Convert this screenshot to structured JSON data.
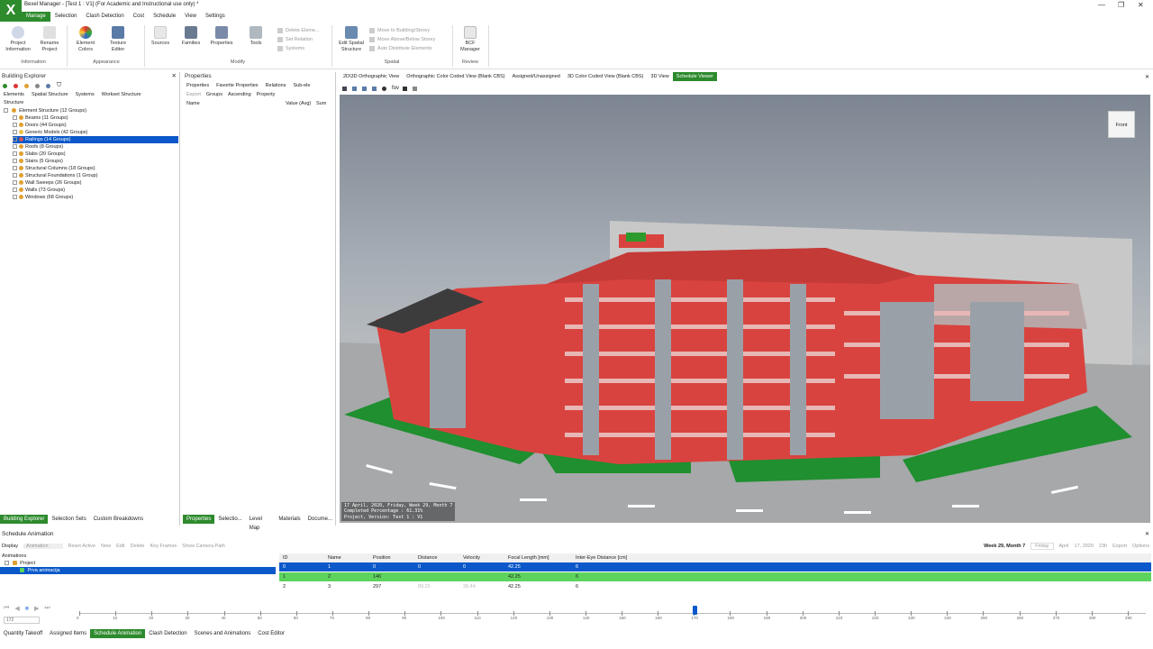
{
  "window": {
    "title": "Bexel Manager - [Test 1 : V1] (For Academic and Instructional use only) *",
    "logo": "X"
  },
  "menu": [
    "Manage",
    "Selection",
    "Clash Detection",
    "Cost",
    "Schedule",
    "View",
    "Settings"
  ],
  "ribbon": {
    "buttons": {
      "project_info": "Project Information",
      "rename_project": "Rename Project",
      "element_colors": "Element Colors",
      "texture_editor": "Texture Editor",
      "sources": "Sources",
      "families": "Families",
      "properties": "Properties",
      "tools": "Tools",
      "edit_spatial": "Edit Spatial Structure",
      "bcf_manager": "BCF Manager"
    },
    "small_items": {
      "delete_elements": "Delete Eleme...",
      "set_relation": "Set Relation",
      "systems": "Systems",
      "move_building": "Move to Building/Storey",
      "move_above": "Move Above/Below Storey",
      "auto_distribute": "Auto Distribute Elements"
    },
    "groups": {
      "information": "Information",
      "appearance": "Appearance",
      "modify": "Modify",
      "spatial": "Spatial",
      "review": "Review"
    }
  },
  "building_explorer": {
    "title": "Building Explorer",
    "tabs": [
      "Elements",
      "Spatial Structure",
      "Systems",
      "Workset Structure"
    ],
    "structure_label": "Structure",
    "root": "Element Structure (12 Groups)",
    "items": [
      "Beams (11 Groups)",
      "Doors (44 Groups)",
      "Generic Models (42 Groups)",
      "Railings (14 Groups)",
      "Roofs (8 Groups)",
      "Slabs (20 Groups)",
      "Stairs (5 Groups)",
      "Structural Columns (18 Groups)",
      "Structural Foundations (1 Group)",
      "Wall Sweeps (26 Groups)",
      "Walls (73 Groups)",
      "Windows (68 Groups)"
    ],
    "selected_index": 3,
    "dot_colors": [
      "#e0a030",
      "#e0a030",
      "#f0c040",
      "#d05050",
      "#e0a030",
      "#e0a030",
      "#e0a030",
      "#e0a030",
      "#e0a030",
      "#e0a030",
      "#e0a030",
      "#e0a030"
    ],
    "bottom_tabs": [
      "Building Explorer",
      "Selection Sets",
      "Custom Breakdowns"
    ]
  },
  "properties_panel": {
    "title": "Properties",
    "tabs": [
      "Properties",
      "Favorite Properties",
      "Relations",
      "Sub-ele"
    ],
    "toolbar": {
      "export": "Export",
      "groups": "Groups",
      "ascending": "Ascending",
      "property": "Property"
    },
    "columns": [
      "Name",
      "Value (Avg)",
      "Sum"
    ],
    "bottom_tabs": [
      "Properties",
      "Selectio...",
      "Level Map",
      "Materials",
      "Docume..."
    ]
  },
  "viewer": {
    "tabs": [
      "2D\\3D Orthographic View",
      "Orthographic Color Coded View (Blank CBS)",
      "Assigned/Unassigned",
      "3D Color Coded View (Blank CBS)",
      "3D View",
      "Schedule Viewer"
    ],
    "selected_tab": 5,
    "toolbar_fov": "fov",
    "view_cube": "Front",
    "overlay_lines": [
      "17 April, 2020, Friday, Week 29, Month 7",
      "Completed Percentage : 61.31%",
      "Project, Version: Test 1 : V1"
    ]
  },
  "schedule_animation": {
    "title": "Schedule Animation",
    "display_label": "Display",
    "display_value": "Animation",
    "toolbar": [
      "Reset Active",
      "New",
      "Edit",
      "Delete",
      "Key Frames",
      "Show Camera Path"
    ],
    "week_label": "Week 29, Month 7",
    "date": {
      "day": "Friday",
      "month": "April",
      "date": "17, 2020",
      "hour": "23h"
    },
    "export": "Export",
    "options": "Options",
    "tree": {
      "root": "Animations",
      "project": "Project",
      "item": "Prva animacija"
    },
    "columns": [
      "ID",
      "Name",
      "Position",
      "Distance",
      "Velocity",
      "Focal Length [mm]",
      "Inter-Eye Distance [cm]"
    ],
    "rows": [
      [
        "0",
        "1",
        "0",
        "0",
        "0",
        "42.25",
        "6"
      ],
      [
        "1",
        "2",
        "146",
        "",
        "",
        "42.25",
        "6"
      ],
      [
        "2",
        "3",
        "297",
        "89.25",
        "38.44",
        "42.25",
        "6"
      ]
    ],
    "timeline_ticks": [
      "0",
      "10",
      "20",
      "30",
      "40",
      "50",
      "60",
      "70",
      "80",
      "90",
      "100",
      "110",
      "120",
      "130",
      "140",
      "150",
      "160",
      "170",
      "180",
      "190",
      "200",
      "210",
      "220",
      "230",
      "240",
      "250",
      "260",
      "270",
      "280",
      "290"
    ],
    "frame_value": "172"
  },
  "bottom_tabs": [
    "Quantity Takeoff",
    "Assigned Items",
    "Schedule Animation",
    "Clash Detection",
    "Scenes and Animations",
    "Cost Editor"
  ],
  "bottom_selected": 2
}
